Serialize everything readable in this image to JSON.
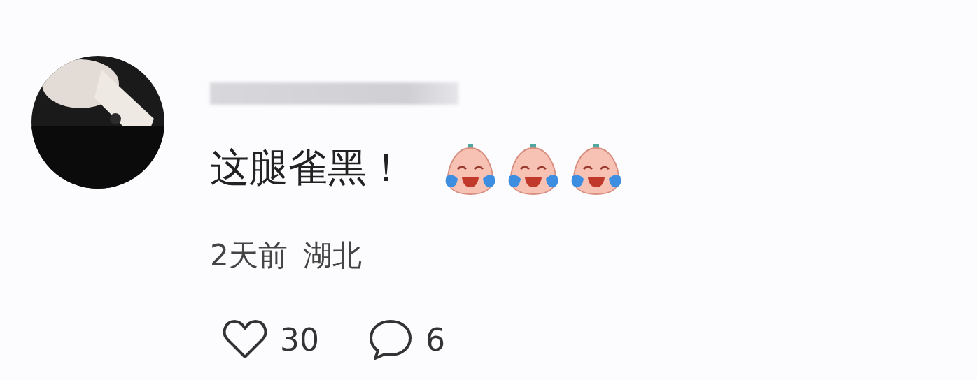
{
  "comment": {
    "text": "这腿雀黑！",
    "time": "2天前",
    "location": "湖北",
    "likes": "30",
    "replies": "6"
  }
}
